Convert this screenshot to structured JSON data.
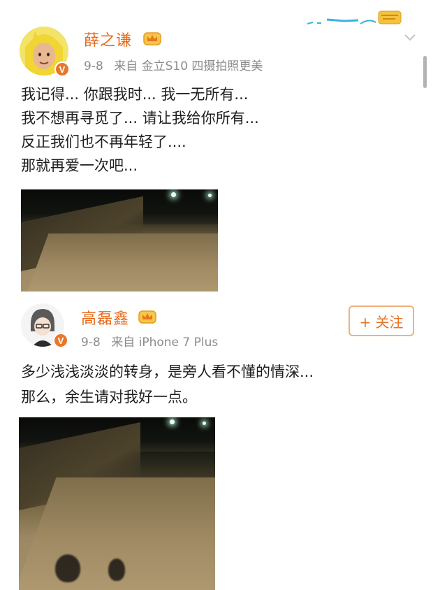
{
  "posts": [
    {
      "username": "薛之谦",
      "date": "9-8",
      "source": "来自 金立S10 四摄拍照更美",
      "lines": [
        "我记得... 你跟我时... 我一无所有...",
        "我不想再寻觅了... 请让我给你所有...",
        "反正我们也不再年轻了....",
        "那就再爱一次吧..."
      ],
      "verified_badge": "V",
      "photo": "night-road-photo"
    },
    {
      "username": "高磊鑫",
      "date": "9-8",
      "source": "来自 iPhone 7 Plus",
      "lines": [
        "多少浅浅淡淡的转身，是旁人看不懂的情深...",
        "那么，余生请对我好一点。"
      ],
      "verified_badge": "V",
      "follow_label": "+ 关注",
      "photo": "night-road-photo-with-shadows"
    }
  ],
  "colors": {
    "username": "#e86b1d",
    "meta": "#8c8c8c",
    "verified": "#e8762d",
    "follow_border": "#f0b27a"
  },
  "icons": [
    "crown-icon",
    "chevron-down-icon",
    "decorative-sticker"
  ]
}
